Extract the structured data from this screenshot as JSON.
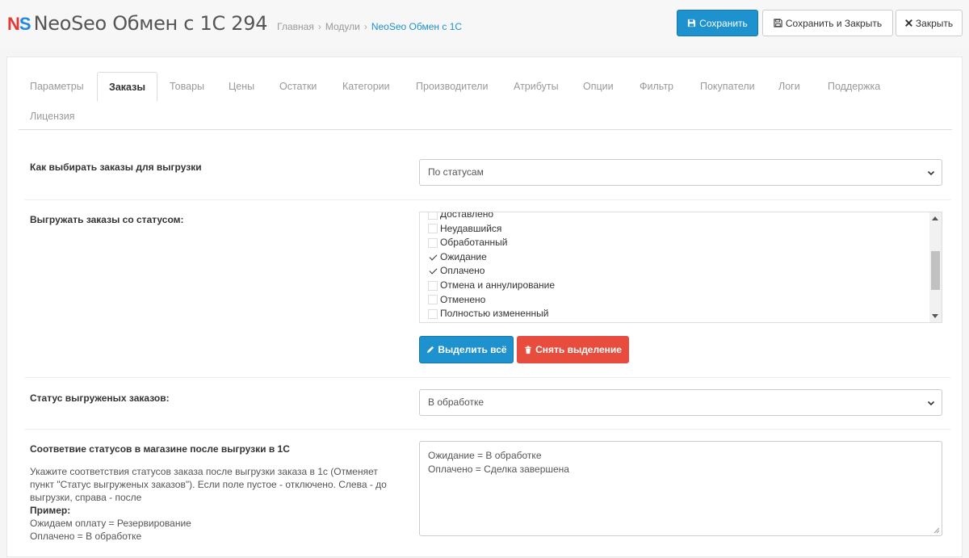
{
  "header": {
    "logo_n": "N",
    "logo_s": "S",
    "title": "NeoSeo Обмен с 1С 294",
    "breadcrumb": [
      {
        "label": "Главная"
      },
      {
        "label": "Модули"
      },
      {
        "label": "NeoSeo Обмен с 1С"
      }
    ],
    "buttons": {
      "save": "Сохранить",
      "save_close": "Сохранить и Закрыть",
      "close": "Закрыть"
    },
    "colors": {
      "accent": "#1e91cf",
      "logo_n": "#e53935",
      "logo_s": "#1e88e5"
    }
  },
  "tabs": [
    {
      "label": "Параметры"
    },
    {
      "label": "Заказы",
      "active": true
    },
    {
      "label": "Товары"
    },
    {
      "label": "Цены"
    },
    {
      "label": "Остатки"
    },
    {
      "label": "Категории"
    },
    {
      "label": "Производители"
    },
    {
      "label": "Атрибуты"
    },
    {
      "label": "Опции"
    },
    {
      "label": "Фильтр"
    },
    {
      "label": "Покупатели"
    },
    {
      "label": "Логи"
    },
    {
      "label": "Поддержка"
    },
    {
      "label": "Лицензия"
    }
  ],
  "form": {
    "order_selection": {
      "label": "Как выбирать заказы для выгрузки",
      "value": "По статусам"
    },
    "export_statuses": {
      "label": "Выгружать заказы со статусом:",
      "items": [
        {
          "label": "Доставлено",
          "checked": false
        },
        {
          "label": "Неудавшийся",
          "checked": false
        },
        {
          "label": "Обработанный",
          "checked": false
        },
        {
          "label": "Ожидание",
          "checked": true
        },
        {
          "label": "Оплачено",
          "checked": true
        },
        {
          "label": "Отмена и аннулирование",
          "checked": false
        },
        {
          "label": "Отменено",
          "checked": false
        },
        {
          "label": "Полностью измененный",
          "checked": false
        }
      ],
      "select_all": "Выделить всё",
      "deselect_all": "Снять выделение"
    },
    "exported_status": {
      "label": "Статус выгруженых заказов:",
      "value": "В обработке"
    },
    "status_mapping": {
      "label": "Соответвие статусов в магазине после выгрузки в 1С",
      "help": "Укажите соответствия статусов заказа после выгрузки заказа в 1с (Отменяет пункт \"Статус выгруженых заказов\"). Если поле пустое - отключено. Слева - до выгрузки, справа - после",
      "example_title": "Пример:",
      "example_lines": [
        "Ожидаем оплату = Резервирование",
        "Оплачено = В обработке"
      ],
      "value_lines": [
        "Ожидание = В обработке",
        "Оплачено = Сделка завершена"
      ]
    }
  }
}
